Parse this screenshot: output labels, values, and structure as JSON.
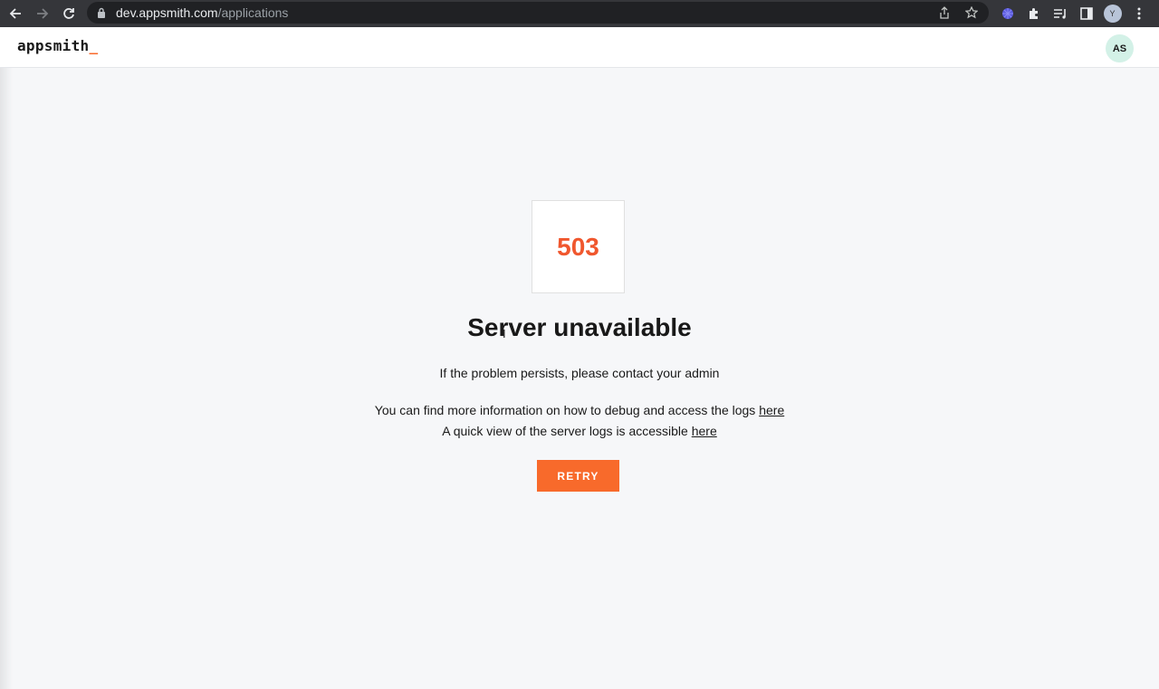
{
  "browser": {
    "url_host": "dev.appsmith.com",
    "url_path": "/applications",
    "profile_initial": "Y"
  },
  "header": {
    "logo_text": "appsmith",
    "logo_cursor": "_",
    "avatar_initials": "AS"
  },
  "error": {
    "code": "503",
    "title": "Server unavailable",
    "message": "If the problem persists, please contact your admin",
    "debug_text": "You can find more information on how to debug and access the logs",
    "debug_link": "here",
    "logs_text": "A quick view of the server logs is accessible",
    "logs_link": "here",
    "retry_label": "RETRY"
  },
  "colors": {
    "accent": "#f86a2b",
    "error_code": "#f0572e",
    "avatar_bg": "#d3f1e7",
    "page_bg": "#f6f7f9"
  }
}
